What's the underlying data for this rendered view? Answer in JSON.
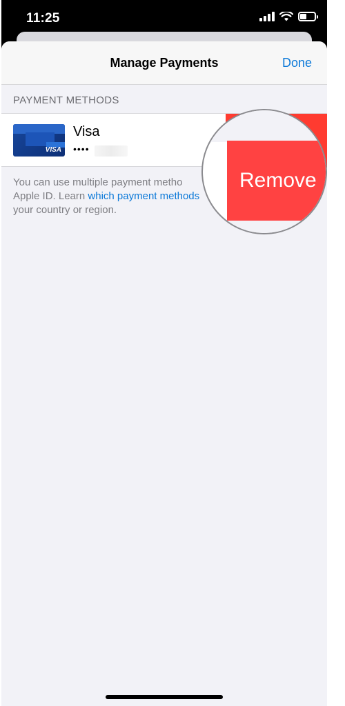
{
  "status_bar": {
    "time": "11:25"
  },
  "nav": {
    "title": "Manage Payments",
    "done_label": "Done"
  },
  "section": {
    "header": "PAYMENT METHODS"
  },
  "payment": {
    "card_name": "Visa",
    "card_mask": "••••",
    "card_logo_text": "VISA"
  },
  "action": {
    "remove_label": "Remove"
  },
  "info": {
    "line_one": "You can use multiple payment metho",
    "line_two_prefix": "Apple ID. Learn ",
    "link_text": "which payment methods",
    "line_two_suffix": " ",
    "line_three": "your country or region.",
    "zoom_fragment": "ur"
  },
  "colors": {
    "accent": "#0a78d8",
    "danger": "#ff3b30",
    "background": "#f2f2f7"
  },
  "icons": {
    "signal": "signal-icon",
    "wifi": "wifi-icon",
    "battery": "battery-icon"
  }
}
